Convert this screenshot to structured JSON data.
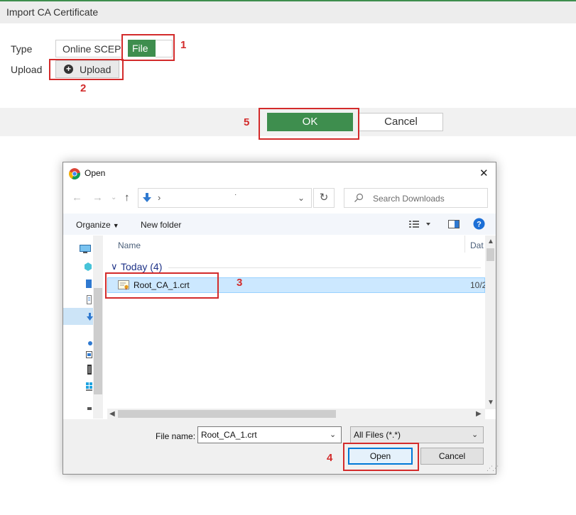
{
  "panel": {
    "title": "Import CA Certificate",
    "type_label": "Type",
    "upload_label": "Upload",
    "type_options": [
      "Online SCEP",
      "File"
    ],
    "selected_type": "File",
    "upload_button": "Upload",
    "ok_button": "OK",
    "cancel_button": "Cancel"
  },
  "annotations": [
    "1",
    "2",
    "3",
    "4",
    "5"
  ],
  "dialog": {
    "title": "Open",
    "close_glyph": "✕",
    "address_chevron": "›",
    "address_dot": "·",
    "search_placeholder": "Search Downloads",
    "toolbar": {
      "organize": "Organize",
      "new_folder": "New folder"
    },
    "columns": {
      "name": "Name",
      "date": "Dat"
    },
    "group_label": "Today (4)",
    "file": {
      "name": "Root_CA_1.crt",
      "date": "10/2"
    },
    "file_name_label": "File name:",
    "file_name_value": "Root_CA_1.crt",
    "file_type_value": "All Files (*.*)",
    "open_button": "Open",
    "cancel_button": "Cancel"
  },
  "colors": {
    "accent": "#3e8e4e",
    "annotation": "#d32b2b",
    "selection": "#cce8ff",
    "focus": "#0078d7"
  }
}
